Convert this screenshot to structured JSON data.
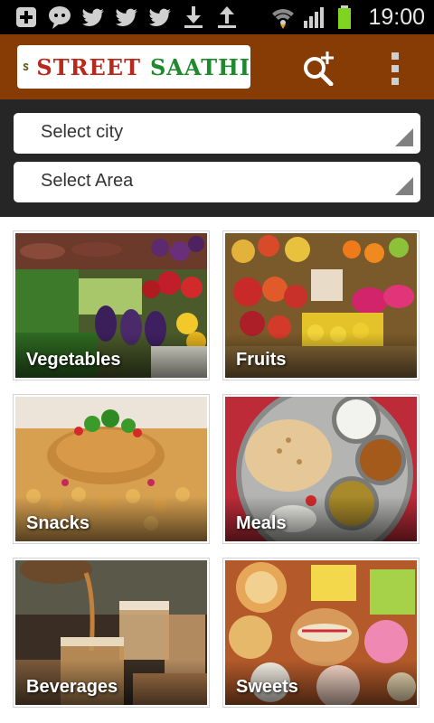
{
  "status_bar": {
    "time": "19:00",
    "icons": [
      "add-notification-icon",
      "chat-notification-icon",
      "twitter-icon",
      "twitter-icon",
      "twitter-icon",
      "download-icon",
      "upload-icon",
      "wifi-icon",
      "signal-icon",
      "battery-icon"
    ],
    "battery_color": "#7fd321"
  },
  "app_bar": {
    "logo_word_1": "STREET",
    "logo_word_2": "SAATHI",
    "brand_color": "#873b05",
    "search_icon": "search-plus-icon",
    "menu_icon": "overflow-menu-icon"
  },
  "filters": {
    "city_placeholder": "Select city",
    "area_placeholder": "Select Area"
  },
  "categories": [
    {
      "label": "Vegetables"
    },
    {
      "label": "Fruits"
    },
    {
      "label": "Snacks"
    },
    {
      "label": "Meals"
    },
    {
      "label": "Beverages"
    },
    {
      "label": "Sweets"
    }
  ]
}
